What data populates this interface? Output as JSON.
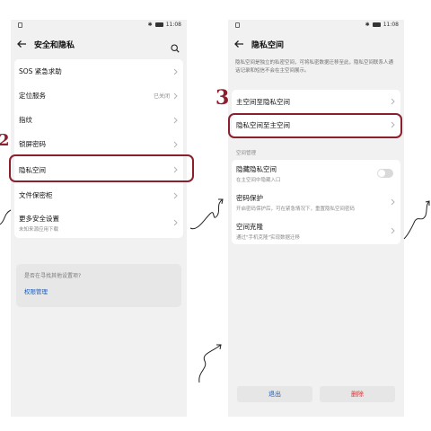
{
  "status": {
    "time": "11:08"
  },
  "left": {
    "title": "安全和隐私",
    "items": [
      {
        "label": "SOS 紧急求助"
      },
      {
        "label": "定位服务",
        "value": "已关闭"
      },
      {
        "label": "指纹"
      },
      {
        "label": "锁屏密码"
      },
      {
        "label": "隐私空间"
      },
      {
        "label": "文件保密柜"
      },
      {
        "label": "更多安全设置",
        "sub": "未知来源应用下载"
      }
    ],
    "help": {
      "question": "是否在寻找其他设置项?",
      "link": "权限管理"
    }
  },
  "right": {
    "title": "隐私空间",
    "description": "隐私空间是独立的私密空间，可将私密数据迁移至此，隐私空间联系人通话记录和短信不会在主空间展示。",
    "items": [
      {
        "label": "主空间至隐私空间"
      },
      {
        "label": "隐私空间至主空间"
      }
    ],
    "section_label": "空间管理",
    "manage": [
      {
        "label": "隐藏隐私空间",
        "sub": "在主空间中隐藏入口"
      },
      {
        "label": "密码保护",
        "sub": "开启密码保护后，可在紧急情况下，重置隐私空间密码"
      },
      {
        "label": "空间克隆",
        "sub": "通过\"手机克隆\"实现数据迁移"
      }
    ],
    "buttons": {
      "exit": "退出",
      "delete": "删除"
    }
  },
  "annotations": {
    "step2": "2",
    "step3": "3"
  },
  "colors": {
    "highlight": "#8a1f2e",
    "link": "#1a5bb5",
    "danger": "#e03131"
  }
}
